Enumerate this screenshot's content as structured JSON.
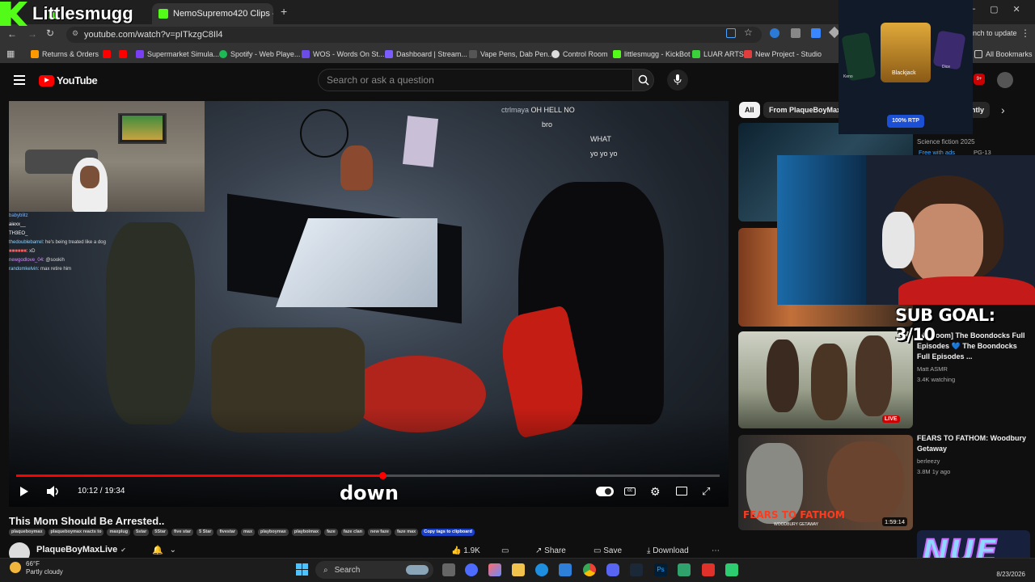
{
  "browser": {
    "tabs": [
      {
        "label": "NemoSupremo420 Clips - Watc",
        "active": true
      }
    ],
    "new_tab": "+",
    "url": "youtube.com/watch?v=pITkzgC8Il4",
    "update_label": "nch to update",
    "bookmarks": [
      {
        "label": "Returns & Orders",
        "color": "#ff9900"
      },
      {
        "label": "",
        "color": "#ff0000"
      },
      {
        "label": "",
        "color": "#ff0000"
      },
      {
        "label": "Supermarket Simula...",
        "color": "#7a3ef5"
      },
      {
        "label": "Spotify - Web Playe...",
        "color": "#1db954"
      },
      {
        "label": "WOS - Words On St...",
        "color": "#6b4ce6"
      },
      {
        "label": "Dashboard | Stream...",
        "color": "#7b5cff"
      },
      {
        "label": "Vape Pens, Dab Pen...",
        "color": "#555555"
      },
      {
        "label": "Control Room",
        "color": "#dddddd"
      },
      {
        "label": "littlesmugg - KickBot",
        "color": "#53fc18"
      },
      {
        "label": "LUAR ARTS",
        "color": "#3ad13a"
      },
      {
        "label": "New Project - Studio",
        "color": "#e23d3d"
      }
    ],
    "all_bookmarks": "All Bookmarks"
  },
  "overlay": {
    "streamer_name": "Littlesmugg",
    "casino_game": "Blackjack",
    "casino_left": "Keno",
    "casino_right": "Dice",
    "casino_rtp": "100% RTP",
    "sub_goal": "SUB GOAL: 3/10",
    "brand": "NUE"
  },
  "youtube": {
    "logo": "YouTube",
    "search_placeholder": "Search or ask a question",
    "notif_count": "9+"
  },
  "player": {
    "time": "10:12 / 19:34",
    "progress_fraction": 0.521,
    "caption_word": "down",
    "overlay_chat": [
      {
        "user": "babyblitz",
        "msg": ""
      },
      {
        "user": "aiexx__",
        "msg": ""
      },
      {
        "user": "TH3EO_",
        "msg": ""
      },
      {
        "user": "thedoublebarrel",
        "msg": "he's being treated like a dog"
      },
      {
        "user": "",
        "msg": "xD"
      },
      {
        "user": "newgodlove_04",
        "msg": "@sookih"
      },
      {
        "user": "randomkelvin",
        "msg": "max retire him"
      }
    ],
    "top_chat": [
      {
        "user": "ctrlmaya",
        "msg": "OH HELL NO"
      },
      {
        "user": "",
        "msg": "bro"
      },
      {
        "user": "",
        "msg": "WHAT"
      },
      {
        "user": "",
        "msg": "yo yo yo"
      }
    ]
  },
  "video": {
    "title": "This Mom Should Be Arrested..",
    "tags": [
      "plaqueboymax",
      "plaqueboymax reacts to",
      "maxplug",
      "5star",
      "5Star",
      "five star",
      "5 Star",
      "fivestar",
      "max",
      "playboymax",
      "playboimax",
      "faze",
      "faze clan",
      "new faze",
      "faze max"
    ],
    "copy_tags": "Copy tags to clipboard",
    "channel": "PlaqueBoyMaxLive",
    "like_count": "1.9K",
    "share": "Share",
    "save": "Save",
    "download": "Download"
  },
  "sidebar": {
    "chips": [
      "All",
      "From PlaqueBoyMax",
      "ntly"
    ],
    "items": [
      {
        "title": "",
        "meta1": "Science fiction 2025",
        "meta2": "Free with ads",
        "rating": "PG-13"
      },
      {
        "title": "",
        "meta1": "",
        "meta2": ""
      },
      {
        "title": "[No Zoom] The Boondocks Full Episodes 💙 The Boondocks Full Episodes ...",
        "channel": "Matt ASMR",
        "meta": "3.4K watching",
        "badge": "LIVE"
      },
      {
        "title": "FEARS TO FATHOM: Woodbury Getaway",
        "channel": "berleezy",
        "meta": "3.8M  1y ago",
        "duration": "1:59:14",
        "thumb_text": "FEARS TO FATHOM",
        "thumb_sub": "WOODBURY GETAWAY"
      }
    ]
  },
  "taskbar": {
    "temp": "66°F",
    "condition": "Partly cloudy",
    "search": "Search",
    "date": "8/23/2026"
  }
}
